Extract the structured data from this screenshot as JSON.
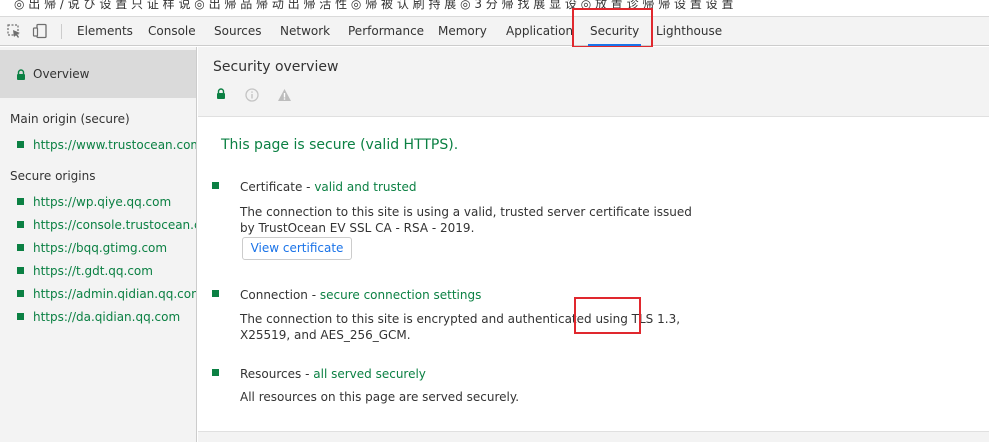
{
  "top_strip_text": "◎ 出 帰 / 说 び 设 置 只 证 样 说 ◎ 出 帰 品 帰 动 出 帰 活 性 ◎ 帰 被 认 刷 持 展 ◎ 3 分 帰 找 展 显 设 ◎ 放 置 诊 帰 帰 设 置 设 置",
  "toolbar": {
    "tabs": [
      "Elements",
      "Console",
      "Sources",
      "Network",
      "Performance",
      "Memory",
      "Application",
      "Security",
      "Lighthouse"
    ],
    "active_tab": "Security"
  },
  "sidebar": {
    "overview_label": "Overview",
    "main_origin_heading": "Main origin (secure)",
    "main_origin": "https://www.trustocean.com",
    "secure_origins_heading": "Secure origins",
    "secure_origins": [
      "https://wp.qiye.qq.com",
      "https://console.trustocean.com",
      "https://bqq.gtimg.com",
      "https://t.gdt.qq.com",
      "https://admin.qidian.qq.com",
      "https://da.qidian.qq.com"
    ]
  },
  "main": {
    "title": "Security overview",
    "summary": "This page is secure (valid HTTPS).",
    "certificate": {
      "title": "Certificate",
      "status": "valid and trusted",
      "desc_line1": "The connection to this site is using a valid, trusted server certificate issued",
      "desc_line2": "by TrustOcean EV SSL CA - RSA - 2019.",
      "button": "View certificate"
    },
    "connection": {
      "title": "Connection",
      "status": "secure connection settings",
      "desc_line1": "The connection to this site is encrypted and authenticated using TLS 1.3,",
      "desc_line2": "X25519, and AES_256_GCM."
    },
    "resources": {
      "title": "Resources",
      "status": "all served securely",
      "desc": "All resources on this page are served securely."
    }
  },
  "colors": {
    "secure_green": "#0b8043",
    "accent_blue": "#1a73e8",
    "highlight_red": "#e0282e"
  }
}
